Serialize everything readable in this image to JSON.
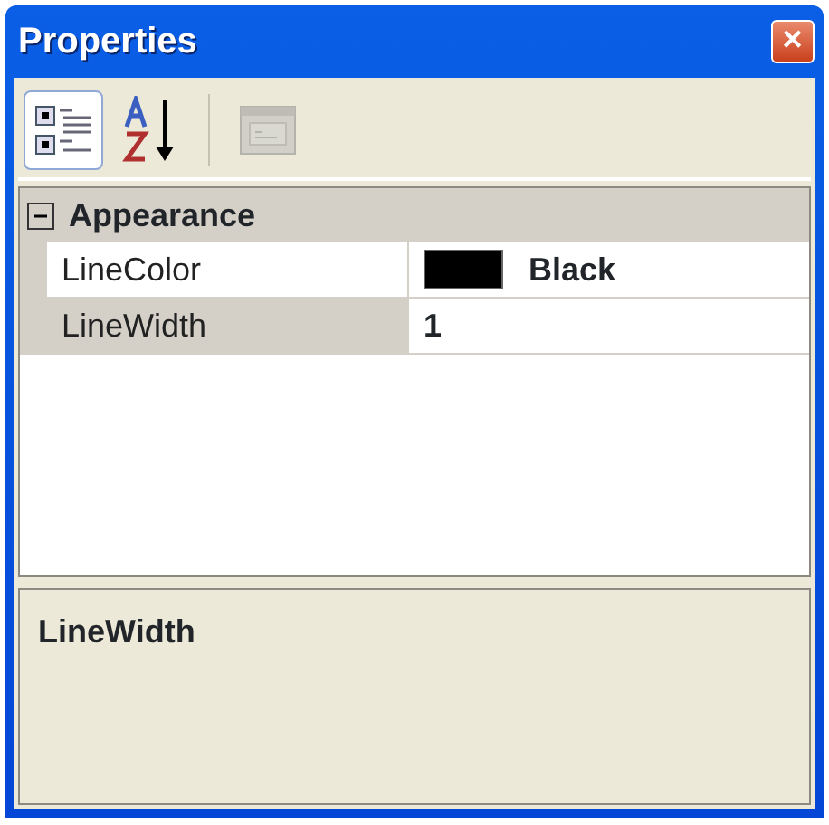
{
  "window": {
    "title": "Properties",
    "close": "✕"
  },
  "toolbar": [
    {
      "kind": "categorized",
      "selected": true,
      "disabled": false
    },
    {
      "kind": "alphabetical",
      "selected": false,
      "disabled": false
    },
    {
      "kind": "property-pages",
      "selected": false,
      "disabled": true
    }
  ],
  "categories": [
    {
      "name": "Appearance",
      "expanded": true,
      "properties": [
        {
          "name": "LineColor",
          "value": "Black",
          "color": "#000000",
          "modified": true,
          "selected": false
        },
        {
          "name": "LineWidth",
          "value": "1",
          "modified": true,
          "selected": true
        }
      ]
    }
  ],
  "description": {
    "title": "LineWidth"
  }
}
